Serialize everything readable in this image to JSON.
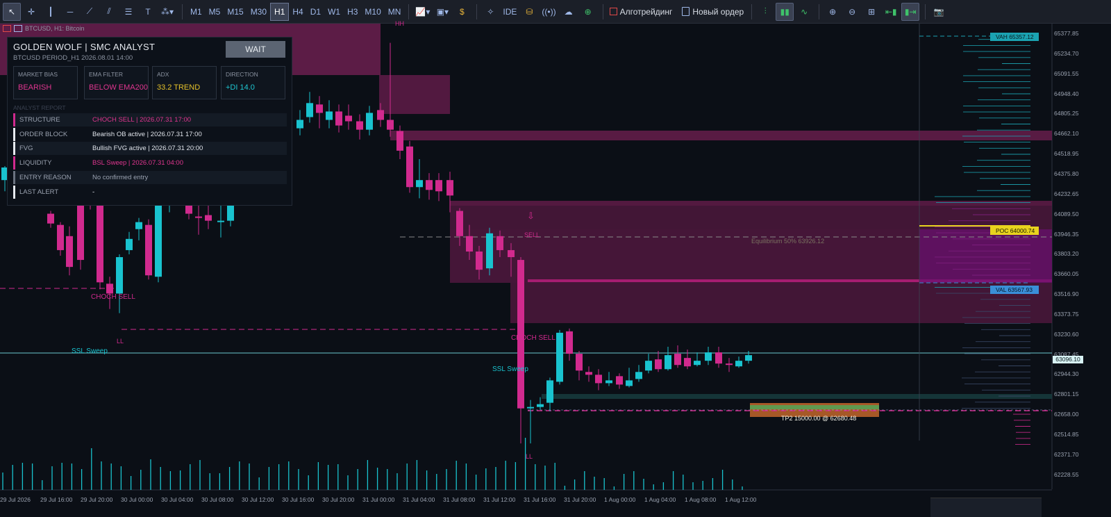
{
  "toolbar": {
    "timeframes": [
      "M1",
      "M5",
      "M15",
      "M30",
      "H1",
      "H4",
      "D1",
      "W1",
      "H3",
      "M10",
      "MN"
    ],
    "active_timeframe": "H1",
    "ide_label": "IDE",
    "algo_label": "Алготрейдинг",
    "new_order_label": "Новый ордер"
  },
  "chart": {
    "symbol_title": "BTCUSD, H1:  Bitcoin",
    "price_labels": [
      "65377.85",
      "65234.70",
      "65091.55",
      "64948.40",
      "64805.25",
      "64662.10",
      "64518.95",
      "64375.80",
      "64232.65",
      "64089.50",
      "63946.35",
      "63803.20",
      "63660.05",
      "63516.90",
      "63373.75",
      "63230.60",
      "63087.45",
      "62944.30",
      "62801.15",
      "62658.00",
      "62514.85",
      "62371.70",
      "62228.55"
    ],
    "current_price": "63096.10",
    "time_labels": [
      "29 Jul 2026",
      "29 Jul 16:00",
      "29 Jul 20:00",
      "30 Jul 00:00",
      "30 Jul 04:00",
      "30 Jul 08:00",
      "30 Jul 12:00",
      "30 Jul 16:00",
      "30 Jul 20:00",
      "31 Jul 00:00",
      "31 Jul 04:00",
      "31 Jul 08:00",
      "31 Jul 12:00",
      "31 Jul 16:00",
      "31 Jul 20:00",
      "1 Aug 00:00",
      "1 Aug 04:00",
      "1 Aug 08:00",
      "1 Aug 12:00"
    ],
    "annotations": {
      "hh": "HH",
      "ll1": "LL",
      "ll2": "LL",
      "choch_sell_1": "CHOCH SELL",
      "choch_sell_2": "CHOCH SELL",
      "ssl_sweep_1": "SSL Sweep",
      "ssl_sweep_2": "SSL Sweep",
      "sell": "SELL",
      "sell_arrow": "⇩",
      "equilibrium": "Equilibrium 50%  63926.12",
      "tp_label": "TP2  15000.00  @ 62680.48"
    },
    "volume_profile": {
      "vah": "VAH 65357.12",
      "poc": "POC 64000.74",
      "val": "VAL 63567.93"
    },
    "colors": {
      "bull": "#19c3cf",
      "bear": "#d12a8e",
      "zone": "#6b1e4f",
      "vah": "#1ba3b2",
      "poc": "#e8d31e",
      "val": "#3a8fd8"
    }
  },
  "panel": {
    "title": "GOLDEN WOLF  |  SMC ANALYST",
    "subtitle": "BTCUSD  PERIOD_H1  2026.08.01 14:00",
    "signal_button": "WAIT",
    "cards": [
      {
        "key": "MARKET BIAS",
        "value": "BEARISH",
        "color": "#e0358f"
      },
      {
        "key": "EMA FILTER",
        "value": "BELOW EMA200",
        "color": "#e0358f"
      },
      {
        "key": "ADX",
        "value": "33.2 TREND",
        "color": "#e5c12a"
      },
      {
        "key": "DIRECTION",
        "value": "+DI 14.0",
        "color": "#1fc7d2"
      }
    ],
    "section_title": "ANALYST REPORT",
    "rows": [
      {
        "label": "STRUCTURE",
        "value": "CHOCH SELL | 2026.07.31 17:00",
        "bar": "#d12a8e",
        "vcolor": "#e0358f"
      },
      {
        "label": "ORDER BLOCK",
        "value": "Bearish OB active | 2026.07.31 17:00",
        "bar": "#e6e9ef",
        "vcolor": "#dfe3ea"
      },
      {
        "label": "FVG",
        "value": "Bullish FVG active | 2026.07.31 20:00",
        "bar": "#e6e9ef",
        "vcolor": "#dfe3ea"
      },
      {
        "label": "LIQUIDITY",
        "value": "BSL Sweep | 2026.07.31 04:00",
        "bar": "#d12a8e",
        "vcolor": "#e0358f"
      },
      {
        "label": "ENTRY REASON",
        "value": "No confirmed entry",
        "bar": "#6b7380",
        "vcolor": "#9aa2b0"
      },
      {
        "label": "LAST ALERT",
        "value": "-",
        "bar": "#e6e9ef",
        "vcolor": "#dfe3ea"
      }
    ]
  }
}
